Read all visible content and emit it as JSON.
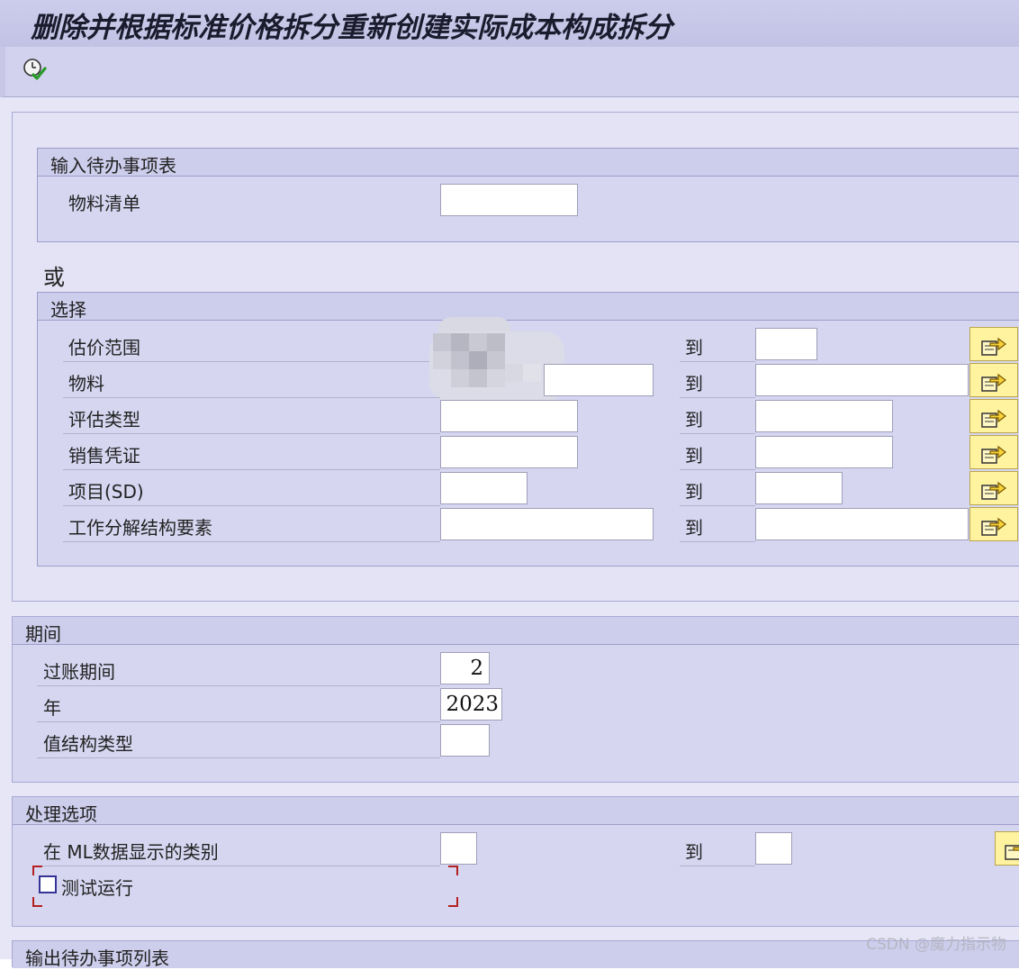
{
  "window": {
    "title": "删除并根据标准价格拆分重新创建实际成本构成拆分"
  },
  "toolbar": {
    "execute_icon": "execute-clock-check-icon"
  },
  "worklist": {
    "header": "输入待办事项表",
    "bom_label": "物料清单",
    "bom_value": ""
  },
  "or_label": "或",
  "selection": {
    "header": "选择",
    "to_label": "到",
    "rows": [
      {
        "label": "估价范围",
        "from": "",
        "to": ""
      },
      {
        "label": "物料",
        "from": "",
        "to": ""
      },
      {
        "label": "评估类型",
        "from": "",
        "to": ""
      },
      {
        "label": "销售凭证",
        "from": "",
        "to": ""
      },
      {
        "label": "项目(SD)",
        "from": "",
        "to": ""
      },
      {
        "label": "工作分解结构要素",
        "from": "",
        "to": ""
      }
    ]
  },
  "period": {
    "header": "期间",
    "posting_period_label": "过账期间",
    "posting_period_value": "2",
    "year_label": "年",
    "year_value": "2023",
    "value_type_label": "值结构类型",
    "value_type_value": ""
  },
  "processing": {
    "header": "处理选项",
    "ml_category_label": "在 ML数据显示的类别",
    "ml_from": "",
    "ml_to": "",
    "to_label": "到",
    "test_run_label": "测试运行",
    "test_run_checked": false
  },
  "output": {
    "header": "输出待办事项列表"
  },
  "watermark": "CSDN @魔力指示物",
  "colors": {
    "title_bar": "#c8c8e8",
    "panel": "#e3e3f5",
    "group_box": "#d6d6f1",
    "multi_select_button": "#fff3a0",
    "focus_frame": "#b32020",
    "checkbox_border": "#343496"
  }
}
